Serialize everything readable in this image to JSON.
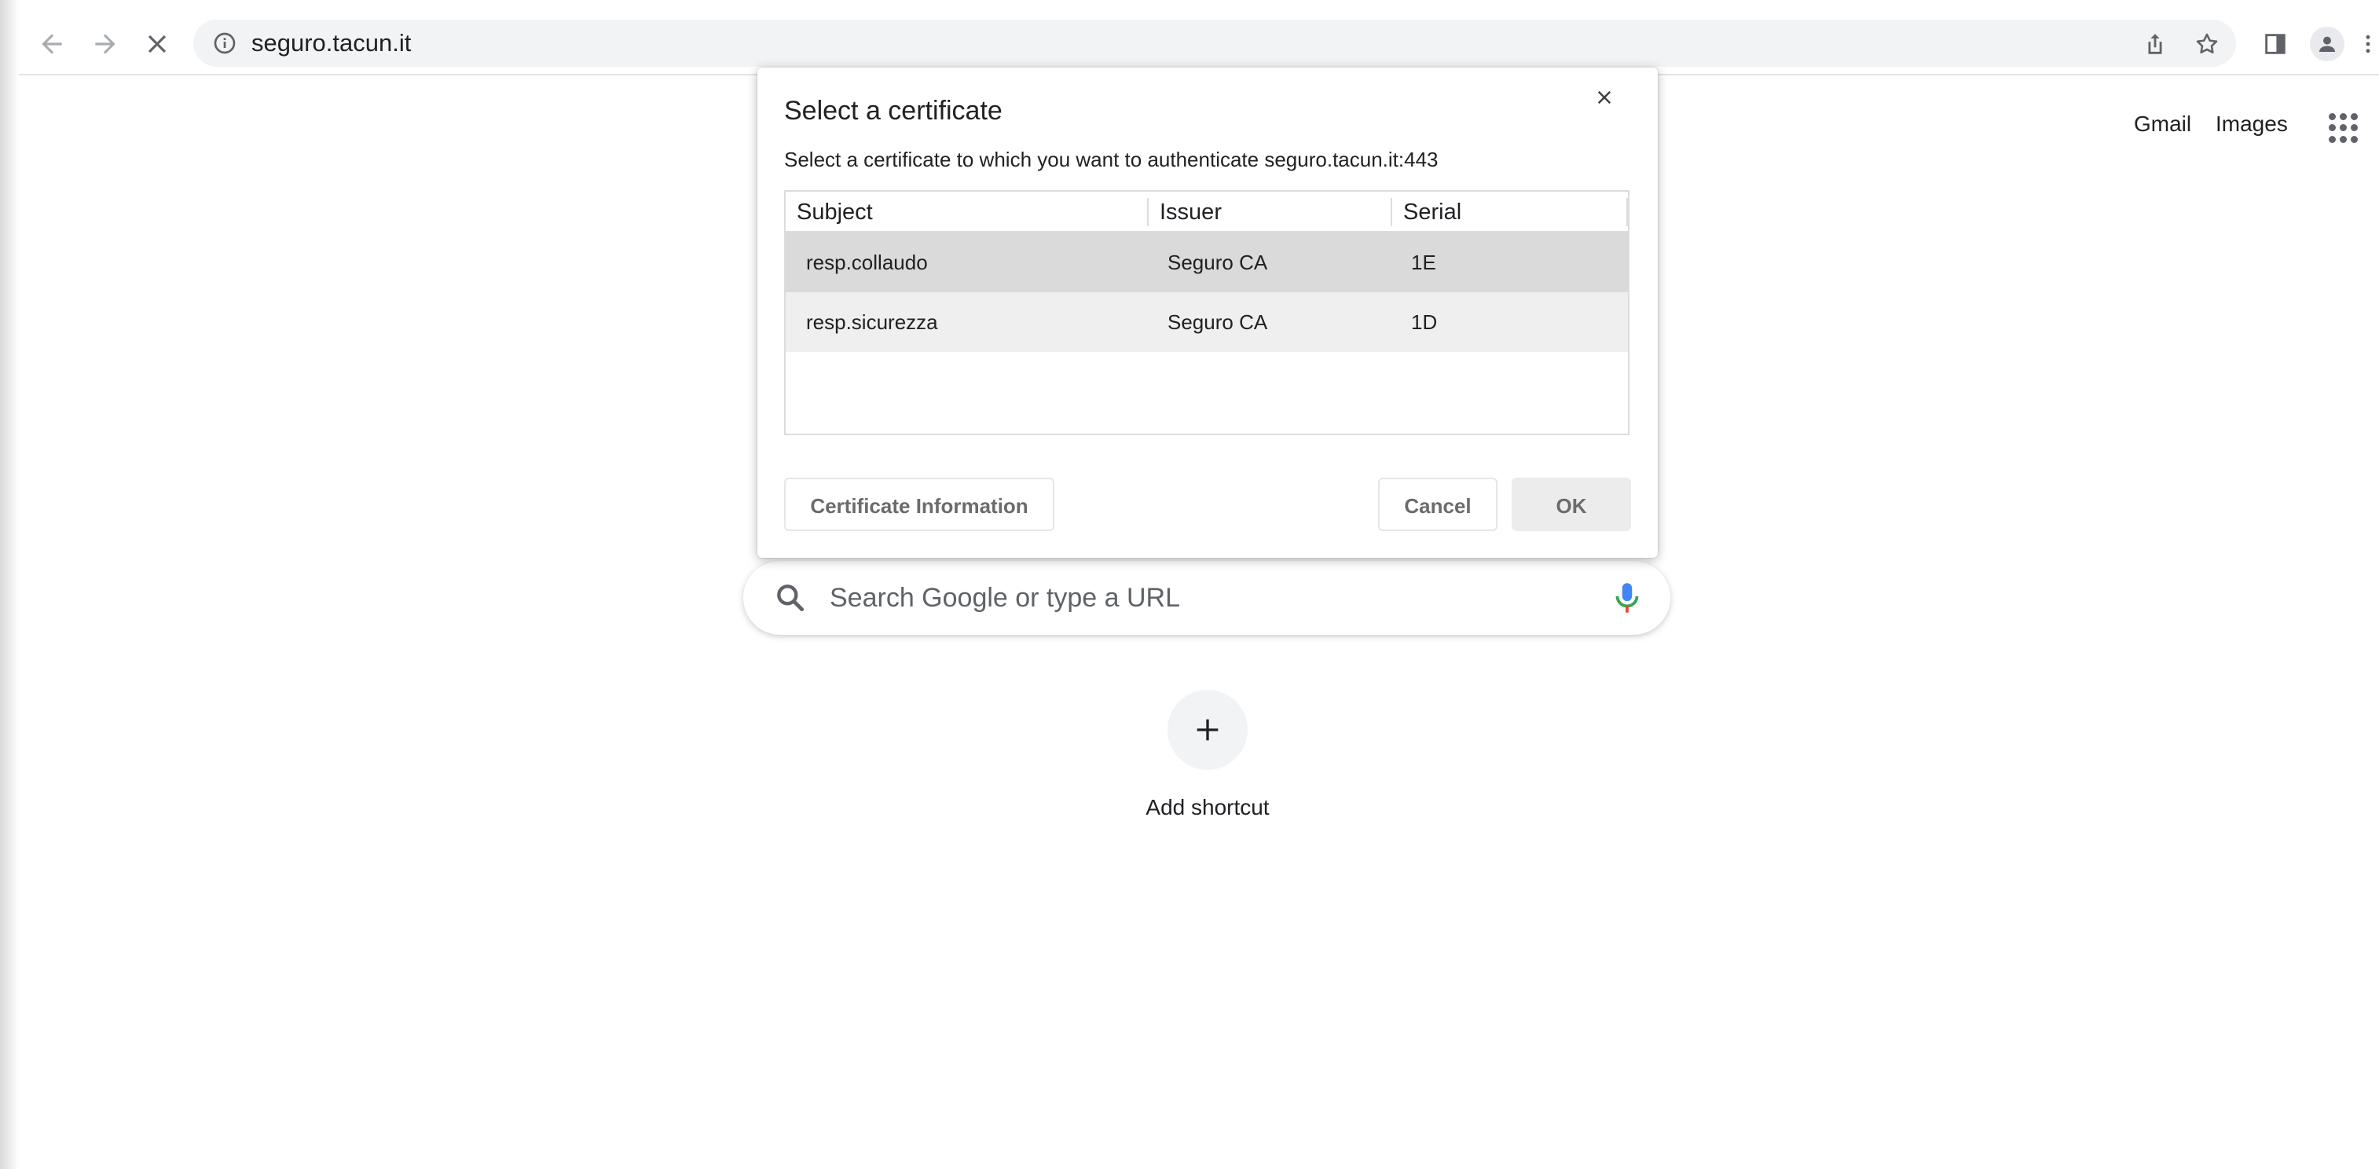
{
  "browser": {
    "url": "seguro.tacun.it",
    "back_icon": "back-arrow-icon",
    "forward_icon": "forward-arrow-icon",
    "stop_icon": "stop-loading-icon"
  },
  "ntp": {
    "links": {
      "gmail": "Gmail",
      "images": "Images"
    },
    "search": {
      "placeholder": "Search Google or type a URL"
    },
    "shortcut": {
      "label": "Add shortcut"
    }
  },
  "dialog": {
    "title": "Select a certificate",
    "subtitle": "Select a certificate to which you want to authenticate seguro.tacun.it:443",
    "columns": {
      "subject": "Subject",
      "issuer": "Issuer",
      "serial": "Serial"
    },
    "rows": [
      {
        "subject": "resp.collaudo",
        "issuer": "Seguro CA",
        "serial": "1E",
        "selected": true
      },
      {
        "subject": "resp.sicurezza",
        "issuer": "Seguro CA",
        "serial": "1D",
        "selected": false
      }
    ],
    "buttons": {
      "info": "Certificate Information",
      "cancel": "Cancel",
      "ok": "OK"
    }
  },
  "colors": {
    "selected_row": "#dadada",
    "unselected_row": "#efefef",
    "mic_blue": "#4285f4",
    "mic_red": "#ea4335"
  }
}
